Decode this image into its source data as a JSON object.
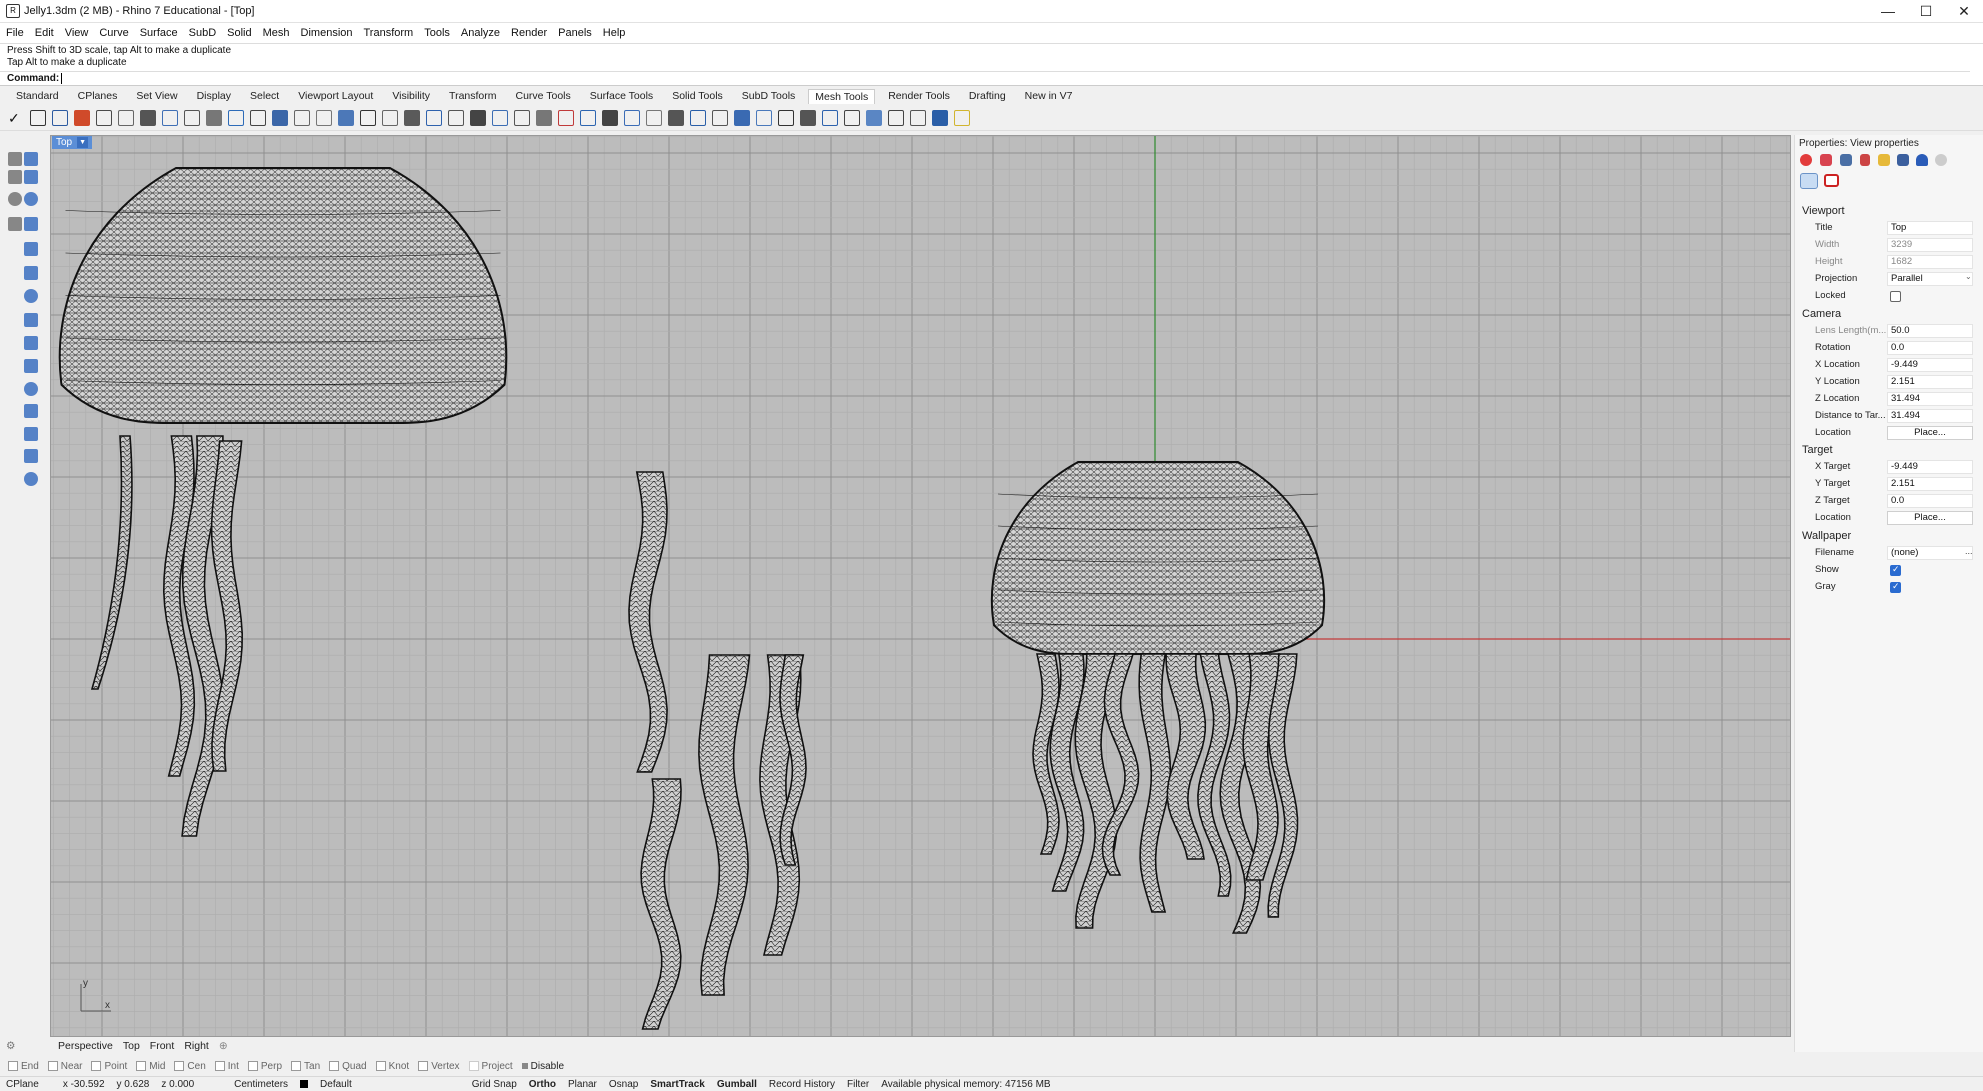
{
  "window": {
    "title": "Jelly1.3dm (2 MB) - Rhino 7 Educational - [Top]",
    "minimize_glyph": "—",
    "maximize_glyph": "☐",
    "close_glyph": "✕"
  },
  "menu": [
    "File",
    "Edit",
    "View",
    "Curve",
    "Surface",
    "SubD",
    "Solid",
    "Mesh",
    "Dimension",
    "Transform",
    "Tools",
    "Analyze",
    "Render",
    "Panels",
    "Help"
  ],
  "command": {
    "history": [
      "Press Shift to 3D scale, tap Alt to make a duplicate",
      "Tap Alt to make a duplicate"
    ],
    "prompt": "Command:"
  },
  "toolbar_tabs": [
    "Standard",
    "CPlanes",
    "Set View",
    "Display",
    "Select",
    "Viewport Layout",
    "Visibility",
    "Transform",
    "Curve Tools",
    "Surface Tools",
    "Solid Tools",
    "SubD Tools",
    "Mesh Tools",
    "Render Tools",
    "Drafting",
    "New in V7"
  ],
  "active_tab": "Mesh Tools",
  "viewport": {
    "name": "Top",
    "axis_x": "x",
    "axis_y": "y",
    "colors": {
      "background": "#bcbcbc",
      "grid_minor": "#adadad",
      "grid_major": "#8f8f8f",
      "x_axis": "#c23b3b",
      "y_axis": "#2e8a2e",
      "mesh": "#111111"
    }
  },
  "viewport_tabs": [
    "Perspective",
    "Top",
    "Front",
    "Right"
  ],
  "panel": {
    "title": "Properties: View properties",
    "sections": {
      "viewport": "Viewport",
      "camera": "Camera",
      "target": "Target",
      "wallpaper": "Wallpaper"
    },
    "viewport": [
      {
        "label": "Title",
        "value": "Top"
      },
      {
        "label": "Width",
        "value": "3239",
        "dim": true
      },
      {
        "label": "Height",
        "value": "1682",
        "dim": true
      },
      {
        "label": "Projection",
        "value": "Parallel"
      },
      {
        "label": "Locked",
        "checkbox": false
      }
    ],
    "camera": [
      {
        "label": "Lens Length(m...",
        "value": "50.0",
        "dim": true
      },
      {
        "label": "Rotation",
        "value": "0.0"
      },
      {
        "label": "X Location",
        "value": "-9.449"
      },
      {
        "label": "Y Location",
        "value": "2.151"
      },
      {
        "label": "Z Location",
        "value": "31.494"
      },
      {
        "label": "Distance to Tar...",
        "value": "31.494"
      },
      {
        "label": "Location",
        "button": "Place..."
      }
    ],
    "target": [
      {
        "label": "X Target",
        "value": "-9.449"
      },
      {
        "label": "Y Target",
        "value": "2.151"
      },
      {
        "label": "Z Target",
        "value": "0.0"
      },
      {
        "label": "Location",
        "button": "Place..."
      }
    ],
    "wallpaper": [
      {
        "label": "Filename",
        "value": "(none)"
      },
      {
        "label": "Show",
        "checkbox": true
      },
      {
        "label": "Gray",
        "checkbox": true
      }
    ]
  },
  "osnaps": [
    "End",
    "Near",
    "Point",
    "Mid",
    "Cen",
    "Int",
    "Perp",
    "Tan",
    "Quad",
    "Knot",
    "Vertex",
    "Project"
  ],
  "osnap_disable": "Disable",
  "status": {
    "cplane": "CPlane",
    "x": "x -30.592",
    "y": "y 0.628",
    "z": "z 0.000",
    "units": "Centimeters",
    "layer": "Default",
    "grid_snap": "Grid Snap",
    "ortho": "Ortho",
    "planar": "Planar",
    "osnap": "Osnap",
    "smarttrack": "SmartTrack",
    "gumball": "Gumball",
    "record_history": "Record History",
    "filter": "Filter",
    "memory": "Available physical memory: 47156 MB"
  }
}
